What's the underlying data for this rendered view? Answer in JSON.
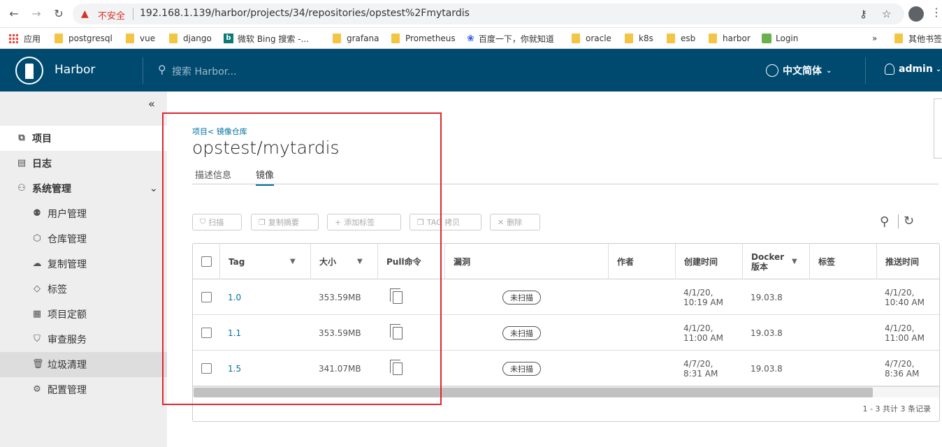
{
  "browser": {
    "insecure_label": "不安全",
    "url": "192.168.1.139/harbor/projects/34/repositories/opstest%2Fmytardis",
    "bookmarks": [
      "应用",
      "postgresql",
      "vue",
      "django",
      "微软 Bing 搜索 -...",
      "grafana",
      "Prometheus",
      "百度一下，你就知道",
      "oracle",
      "k8s",
      "esb",
      "harbor",
      "Login"
    ],
    "overflow": "»",
    "other_bookmarks": "其他书签"
  },
  "header": {
    "brand": "Harbor",
    "search_placeholder": "搜索 Harbor...",
    "language": "中文简体",
    "user": "admin"
  },
  "sidebar": {
    "items": [
      {
        "label": "项目",
        "icon": "project-icon"
      },
      {
        "label": "日志",
        "icon": "log-icon"
      },
      {
        "label": "系统管理",
        "icon": "admin-icon"
      },
      {
        "label": "用户管理",
        "icon": "users-icon"
      },
      {
        "label": "仓库管理",
        "icon": "registry-icon"
      },
      {
        "label": "复制管理",
        "icon": "replication-icon"
      },
      {
        "label": "标签",
        "icon": "tag-icon"
      },
      {
        "label": "项目定额",
        "icon": "quota-icon"
      },
      {
        "label": "审查服务",
        "icon": "shield-icon"
      },
      {
        "label": "垃圾清理",
        "icon": "trash-icon"
      },
      {
        "label": "配置管理",
        "icon": "gear-icon"
      }
    ]
  },
  "main": {
    "breadcrumb": "项目< 镜像仓库",
    "title": "opstest/mytardis",
    "tabs": [
      "描述信息",
      "镜像"
    ],
    "toolbar": {
      "scan": "扫描",
      "copy_digest": "复制摘要",
      "add_label": "添加标签",
      "tag_copy": "TAG 拷贝",
      "delete": "删除"
    },
    "columns": [
      "Tag",
      "大小",
      "Pull命令",
      "漏洞",
      "作者",
      "创建时间",
      "Docker 版本",
      "标签",
      "推送时间"
    ],
    "rows": [
      {
        "tag": "1.0",
        "size": "353.59MB",
        "vuln": "未扫描",
        "created_date": "4/1/20,",
        "created_time": "10:19 AM",
        "docker": "19.03.8",
        "pushed_date": "4/1/20,",
        "pushed_time": "10:40 AM"
      },
      {
        "tag": "1.1",
        "size": "353.59MB",
        "vuln": "未扫描",
        "created_date": "4/1/20,",
        "created_time": "11:00 AM",
        "docker": "19.03.8",
        "pushed_date": "4/1/20,",
        "pushed_time": "11:00 AM"
      },
      {
        "tag": "1.5",
        "size": "341.07MB",
        "vuln": "未扫描",
        "created_date": "4/7/20,",
        "created_time": "8:31 AM",
        "docker": "19.03.8",
        "pushed_date": "4/7/20,",
        "pushed_time": "8:36 AM"
      }
    ],
    "footer": "1 - 3 共计 3 条记录"
  },
  "colors": {
    "header_bg": "#004a70",
    "link": "#0072a3",
    "annotation_box": "#e0262e"
  }
}
